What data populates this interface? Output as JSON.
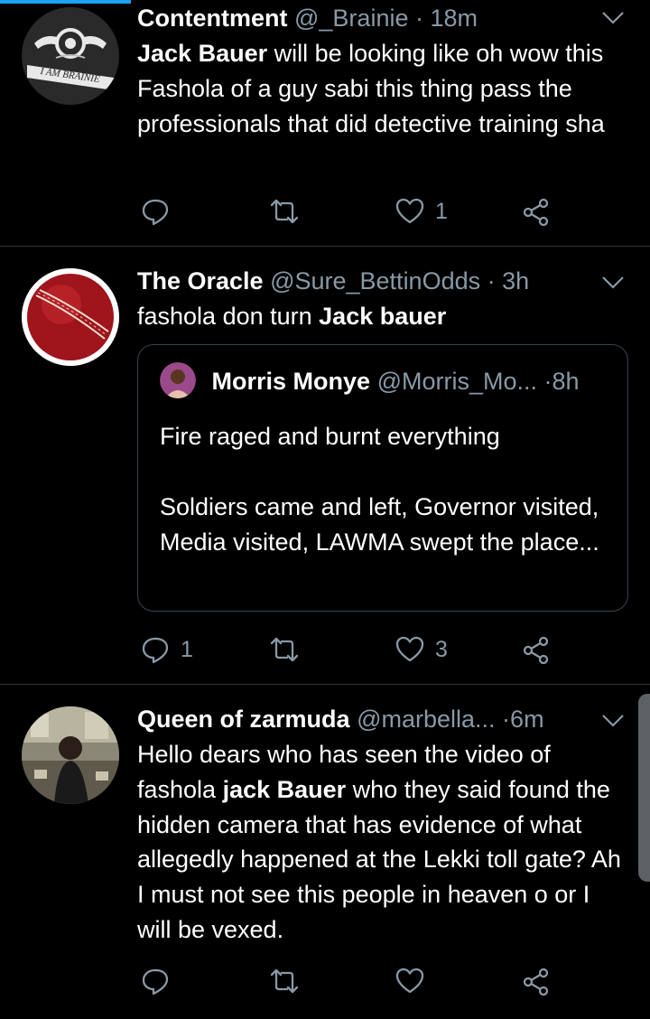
{
  "tweets": [
    {
      "name": "Contentment",
      "handle": "@_Brainie",
      "time": "18m",
      "avatar_text": "I AM BRAINIE",
      "body": [
        {
          "text": "Jack Bauer",
          "bold": true
        },
        {
          "text": " will be looking like oh wow this Fashola of a guy sabi this thing pass the professionals that did detective training sha",
          "bold": false
        }
      ],
      "replies": "",
      "retweets": "",
      "likes": "1"
    },
    {
      "name": "The Oracle",
      "handle": "@Sure_BettinOdds",
      "time": "3h",
      "body": [
        {
          "text": "fashola don turn ",
          "bold": false
        },
        {
          "text": "Jack bauer",
          "bold": true
        }
      ],
      "quote": {
        "name": "Morris Monye",
        "handle": "@Morris_Mo...",
        "time": "8h",
        "paragraphs": [
          "Fire raged and burnt everything",
          "Soldiers came and left, Governor visited, Media visited, LAWMA swept the place..."
        ]
      },
      "replies": "1",
      "retweets": "",
      "likes": "3"
    },
    {
      "name": "Queen of zarmuda",
      "handle": "@marbella...",
      "time": "6m",
      "body": [
        {
          "text": "Hello dears who has seen the video of fashola ",
          "bold": false
        },
        {
          "text": "jack Bauer",
          "bold": true
        },
        {
          "text": " who they said found the hidden camera that has evidence of what allegedly happened at the Lekki toll gate? Ah I must not see this  people in heaven o or I will be vexed.",
          "bold": false
        }
      ],
      "replies": "",
      "retweets": "",
      "likes": ""
    }
  ],
  "icons": {
    "reply": "reply-icon",
    "retweet": "retweet-icon",
    "like": "heart-icon",
    "share": "share-icon",
    "menu": "chevron-down-icon"
  },
  "colors": {
    "background": "#000000",
    "secondary_text": "#8899a6",
    "divider": "#2f3336",
    "accent": "#1da1f2"
  }
}
